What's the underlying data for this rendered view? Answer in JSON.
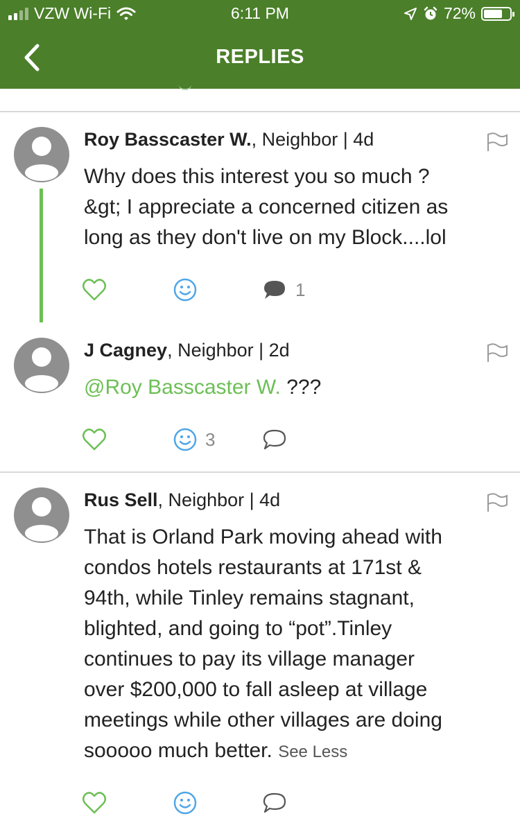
{
  "status_bar": {
    "carrier": "VZW Wi-Fi",
    "time": "6:11 PM",
    "battery": "72%",
    "battery_level": 0.72,
    "icons": [
      "signal-bars-icon",
      "wifi-icon",
      "location-arrow-icon",
      "alarm-icon",
      "battery-icon"
    ]
  },
  "nav": {
    "title": "REPLIES",
    "back_icon": "chevron-left-icon"
  },
  "colors": {
    "header_green": "#4b7f2a",
    "accent_green": "#6cbf55",
    "smiley_blue": "#4fa6e8",
    "avatar_gray": "#8f8f8f"
  },
  "posts": [
    {
      "author": "Roy Basscaster W.",
      "role_time": ", Neighbor | 4d",
      "lines": [
        "Why does this interest you so much ?",
        "&gt; I appreciate a concerned citizen as",
        "long as they don't live on my Block....lol"
      ],
      "reactions_count": "",
      "comments_count": "1"
    },
    {
      "author": "J Cagney",
      "role_time": ", Neighbor | 2d",
      "mention": "@Roy Basscaster W.",
      "text_after_mention": " ???",
      "reactions_count": "3",
      "comments_count": ""
    },
    {
      "author": "Rus Sell",
      "role_time": ", Neighbor | 4d",
      "lines": [
        "That is Orland Park moving ahead with",
        "condos hotels restaurants at 171st &",
        "94th, while Tinley remains stagnant,",
        "blighted, and going to “pot”.Tinley",
        "continues to pay its village manager",
        "over $200,000 to fall asleep at village",
        "meetings while other villages are doing",
        "sooooo much better."
      ],
      "see_less": "See Less",
      "reactions_count": "",
      "comments_count": ""
    }
  ]
}
